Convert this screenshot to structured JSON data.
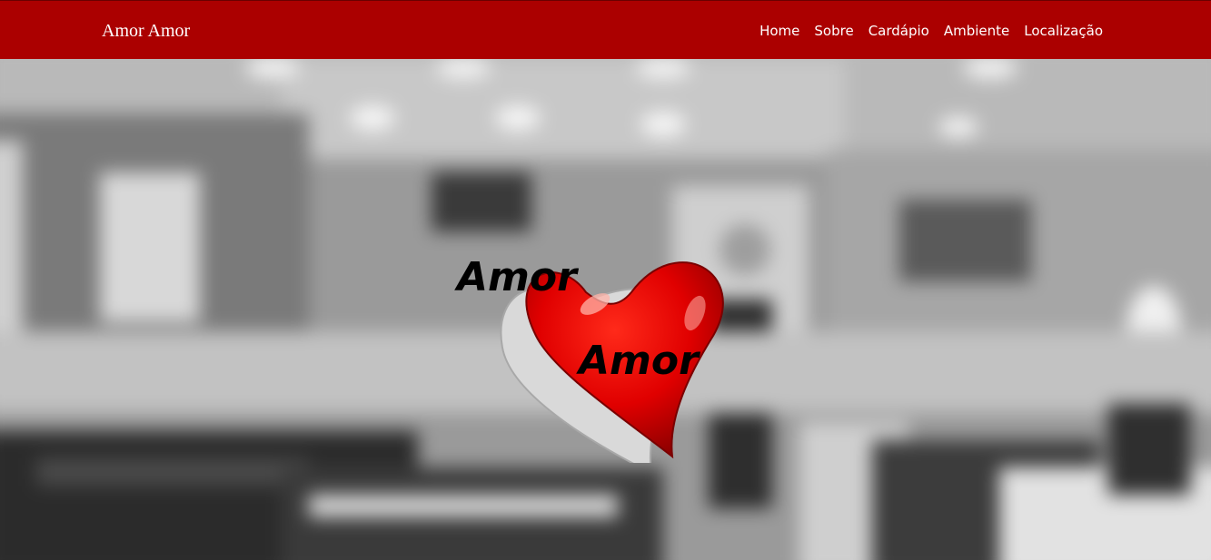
{
  "navbar": {
    "brand": "Amor Amor",
    "links": [
      {
        "label": "Home"
      },
      {
        "label": "Sobre"
      },
      {
        "label": "Cardápio"
      },
      {
        "label": "Ambiente"
      },
      {
        "label": "Localização"
      }
    ]
  },
  "hero": {
    "logo": {
      "word_top": "Amor",
      "word_bottom": "Amor",
      "heart_color": "#e00000",
      "heart_dark": "#8a0000"
    }
  },
  "colors": {
    "navbar_bg": "#ab0000",
    "nav_text": "#ffffff",
    "background_tone": "grayscale"
  },
  "icons": [
    "heart-icon"
  ]
}
